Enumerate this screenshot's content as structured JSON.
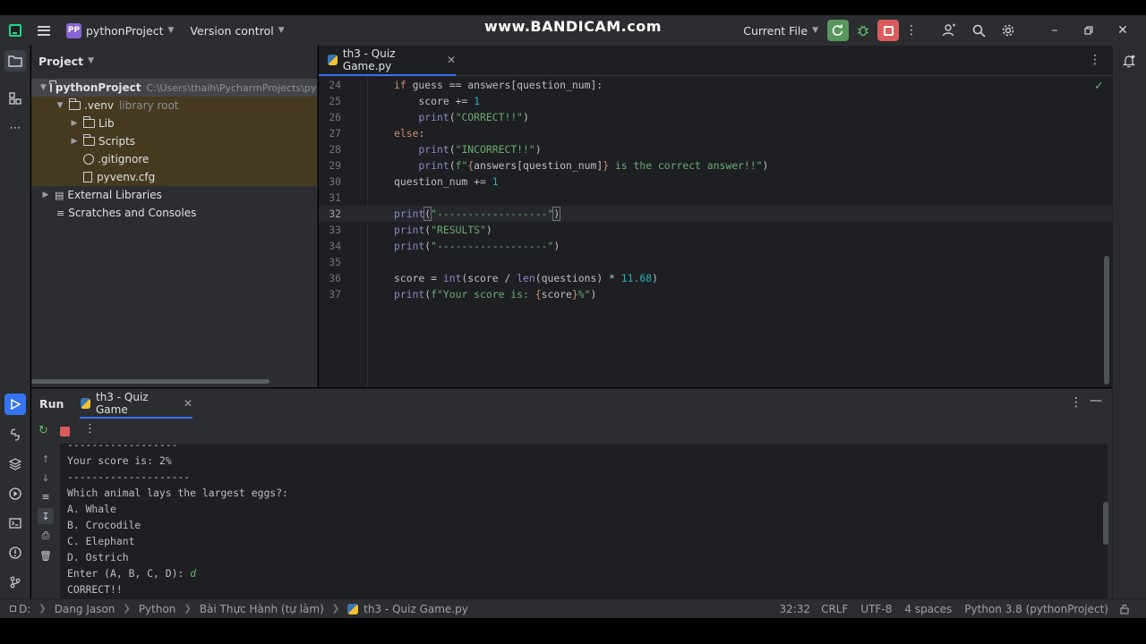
{
  "watermark": "www.BANDICAM.com",
  "titlebar": {
    "project_badge": "PP",
    "project_name": "pythonProject",
    "vcs_label": "Version control",
    "run_config": "Current File"
  },
  "project_panel": {
    "title": "Project",
    "tree": [
      {
        "label": "pythonProject",
        "hint": "C:\\Users\\thaih\\PycharmProjects\\pyth"
      },
      {
        "label": ".venv",
        "hint": "library root"
      },
      {
        "label": "Lib"
      },
      {
        "label": "Scripts"
      },
      {
        "label": ".gitignore"
      },
      {
        "label": "pyvenv.cfg"
      },
      {
        "label": "External Libraries"
      },
      {
        "label": "Scratches and Consoles"
      }
    ]
  },
  "editor": {
    "tab_label": "th3 - Quiz Game.py",
    "line_numbers": [
      "24",
      "25",
      "26",
      "27",
      "28",
      "29",
      "30",
      "31",
      "32",
      "33",
      "34",
      "35",
      "36",
      "37"
    ],
    "current_line": "32"
  },
  "run_panel": {
    "title": "Run",
    "tab_label": "th3 - Quiz Game",
    "console_lines": [
      "------------------",
      "Your score is: 2%",
      "--------------------",
      "Which animal lays the largest eggs?:",
      "A. Whale",
      "B. Crocodile",
      "C. Elephant",
      "D. Ostrich",
      "Enter (A, B, C, D): ",
      "CORRECT!!"
    ],
    "user_input": "d"
  },
  "statusbar": {
    "breadcrumbs": [
      "D:",
      "Dang Jason",
      "Python",
      "Bài Thực Hành (tự làm)",
      "th3 - Quiz Game.py"
    ],
    "position": "32:32",
    "line_separator": "CRLF",
    "encoding": "UTF-8",
    "indent": "4 spaces",
    "interpreter": "Python 3.8 (pythonProject)"
  },
  "colors": {
    "accent": "#3574f0",
    "run_green": "#57965c",
    "stop_red": "#db5c5c",
    "project_badge": "#8a63d2"
  }
}
